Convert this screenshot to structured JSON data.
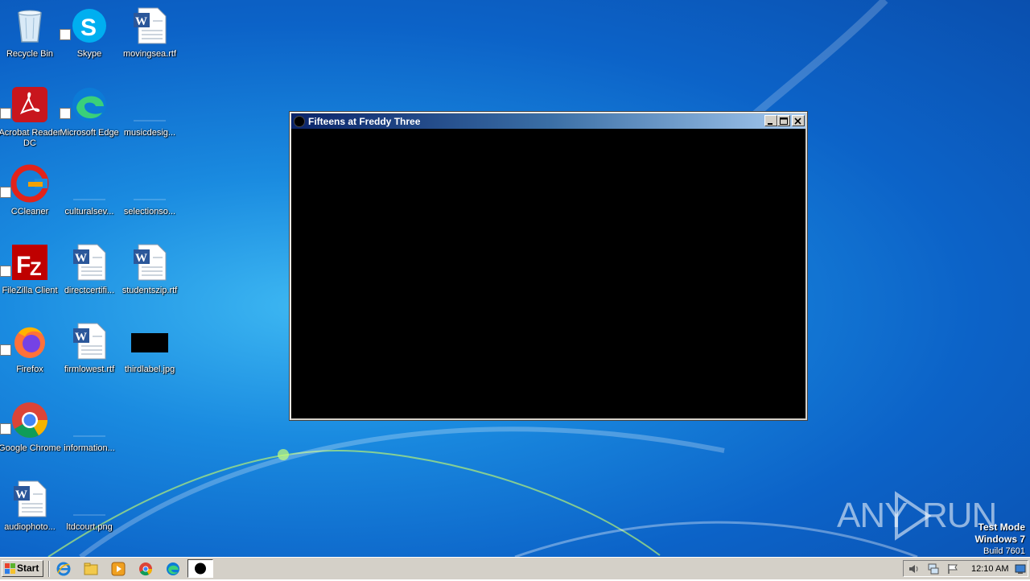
{
  "desktop_icons": [
    {
      "label": "Recycle Bin",
      "icon": "recycle-bin-icon"
    },
    {
      "label": "Skype",
      "icon": "skype-icon"
    },
    {
      "label": "movingsea.rtf",
      "icon": "word-document-icon"
    },
    {
      "label": "Acrobat Reader DC",
      "icon": "acrobat-reader-icon"
    },
    {
      "label": "Microsoft Edge",
      "icon": "edge-icon"
    },
    {
      "label": "musicdesig...",
      "icon": "blank-file-icon"
    },
    {
      "label": "CCleaner",
      "icon": "ccleaner-icon"
    },
    {
      "label": "culturalsev...",
      "icon": "blank-file-icon"
    },
    {
      "label": "selectionso...",
      "icon": "blank-file-icon"
    },
    {
      "label": "FileZilla Client",
      "icon": "filezilla-icon"
    },
    {
      "label": "directcertifi...",
      "icon": "word-document-icon"
    },
    {
      "label": "studentszip.rtf",
      "icon": "word-document-icon"
    },
    {
      "label": "Firefox",
      "icon": "firefox-icon"
    },
    {
      "label": "firmlowest.rtf",
      "icon": "word-document-icon"
    },
    {
      "label": "thirdlabel.jpg",
      "icon": "image-thumbnail-icon"
    },
    {
      "label": "Google Chrome",
      "icon": "chrome-icon"
    },
    {
      "label": "information...",
      "icon": "blank-file-icon"
    },
    {
      "label": "audiophoto...",
      "icon": "word-document-icon"
    },
    {
      "label": "ltdcourt.png",
      "icon": "blank-file-icon"
    }
  ],
  "window": {
    "title": "Fifteens at Freddy Three",
    "minimize_icon": "minimize-icon",
    "maximize_icon": "maximize-icon",
    "close_icon": "close-icon",
    "client_color": "#000000"
  },
  "watermark": {
    "left": "ANY",
    "right": "RUN"
  },
  "os_info": {
    "line1": "Test Mode",
    "line2": "Windows 7",
    "line3": "Build 7601"
  },
  "taskbar": {
    "start_label": "Start",
    "quick_launch": [
      "internet-explorer-icon",
      "file-explorer-icon",
      "media-player-icon",
      "chrome-icon",
      "edge-icon"
    ],
    "active_task_icon": "black-circle-app-icon",
    "tray_icons": [
      "volume-icon",
      "network-icon",
      "action-center-flag-icon"
    ],
    "clock": "12:10 AM",
    "show_desktop_icon": "show-desktop-icon"
  },
  "colors": {
    "desktop_blue": "#1a8be0",
    "taskbar_gray": "#d4d0c8",
    "title_bar_start": "#0a246a",
    "title_bar_end": "#a6caf0"
  }
}
